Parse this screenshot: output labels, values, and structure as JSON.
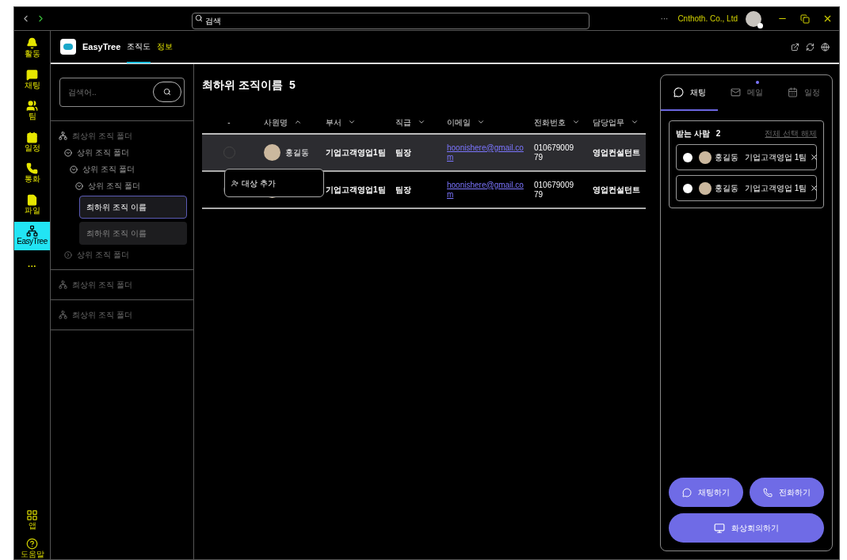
{
  "titlebar": {
    "search_placeholder": "검색",
    "more": "···",
    "company": "Cnthoth. Co., Ltd"
  },
  "sidebar": {
    "items": [
      {
        "kind": "bell",
        "label": "활동",
        "selected": false
      },
      {
        "kind": "chat",
        "label": "채팅",
        "selected": false
      },
      {
        "kind": "team",
        "label": "팀",
        "selected": false
      },
      {
        "kind": "calendar",
        "label": "일정",
        "selected": false
      },
      {
        "kind": "phone",
        "label": "통화",
        "selected": false
      },
      {
        "kind": "file",
        "label": "파일",
        "selected": false
      },
      {
        "kind": "tree",
        "label": "EasyTree",
        "selected": true
      },
      {
        "kind": "more",
        "label": "···",
        "selected": false
      }
    ],
    "bottom": [
      {
        "kind": "apps",
        "label": "앱"
      },
      {
        "kind": "help",
        "label": "도움말"
      }
    ]
  },
  "header": {
    "app_name": "EasyTree",
    "tabs": [
      {
        "label": "조직도",
        "selected": true
      },
      {
        "label": "정보",
        "selected": false
      }
    ]
  },
  "tree": {
    "search_placeholder": "검색어..",
    "groups": [
      {
        "kind": "root",
        "label": "최상위 조직 폴더",
        "expanded": true,
        "children": [
          {
            "kind": "folder",
            "label": "상위 조직 폴더",
            "expanded": true,
            "children": [
              {
                "kind": "folder",
                "label": "상위 조직 폴더",
                "expanded": true,
                "children": [
                  {
                    "kind": "folder",
                    "label": "상위 조직 폴더",
                    "expanded": true,
                    "children": [
                      {
                        "kind": "leaf",
                        "label": "최하위 조직 이름",
                        "selected": true
                      },
                      {
                        "kind": "leaf",
                        "label": "최하위 조직 이름",
                        "selected": false
                      }
                    ]
                  }
                ]
              }
            ]
          },
          {
            "kind": "folder",
            "label": "상위 조직 폴더",
            "expanded": false
          }
        ]
      },
      {
        "kind": "root",
        "label": "최상위 조직 폴더",
        "expanded": false
      },
      {
        "kind": "root",
        "label": "최상위 조직 폴더",
        "expanded": false
      }
    ]
  },
  "main": {
    "title": "최하위 조직이름",
    "count": "5",
    "columns": [
      {
        "label": "-"
      },
      {
        "label": "사원명",
        "ascending": true
      },
      {
        "label": "부서",
        "ascending": false
      },
      {
        "label": "직급",
        "ascending": false
      },
      {
        "label": "이메일",
        "ascending": false
      },
      {
        "label": "전화번호",
        "ascending": false
      },
      {
        "label": "담당업무",
        "ascending": false
      }
    ],
    "rows": [
      {
        "selected": true,
        "name": "홍길동",
        "dept": "기업고객영업1팀",
        "rank": "팀장",
        "email": "hoonishere@gmail.com",
        "phone": "01067900979",
        "duty": "영업컨설턴트"
      },
      {
        "selected": false,
        "dept": "기업고객영업1팀",
        "rank": "팀장",
        "email": "hoonishere@gmail.com",
        "phone": "01067900979",
        "duty": "영업컨설턴트"
      }
    ],
    "popup": {
      "label": "대상 추가"
    }
  },
  "panel": {
    "tabs": [
      {
        "kind": "chat",
        "label": "채팅",
        "selected": true,
        "dot": false
      },
      {
        "kind": "mail",
        "label": "메일",
        "selected": false,
        "dot": true
      },
      {
        "kind": "calendar",
        "label": "일정",
        "selected": false,
        "dot": false
      }
    ],
    "recipients_title": "받는 사람",
    "recipients_count": "2",
    "clear_all": "전체 선택 해제",
    "recipients": [
      {
        "name": "홍길동",
        "dept": "기업고객영업 1팀",
        "selected": false
      },
      {
        "name": "홍길동",
        "dept": "기업고객영업 1팀",
        "selected": false
      }
    ],
    "buttons": [
      {
        "kind": "chat",
        "label": "채팅하기"
      },
      {
        "kind": "phone",
        "label": "전화하기"
      },
      {
        "kind": "video",
        "label": "화상회의하기"
      }
    ]
  }
}
